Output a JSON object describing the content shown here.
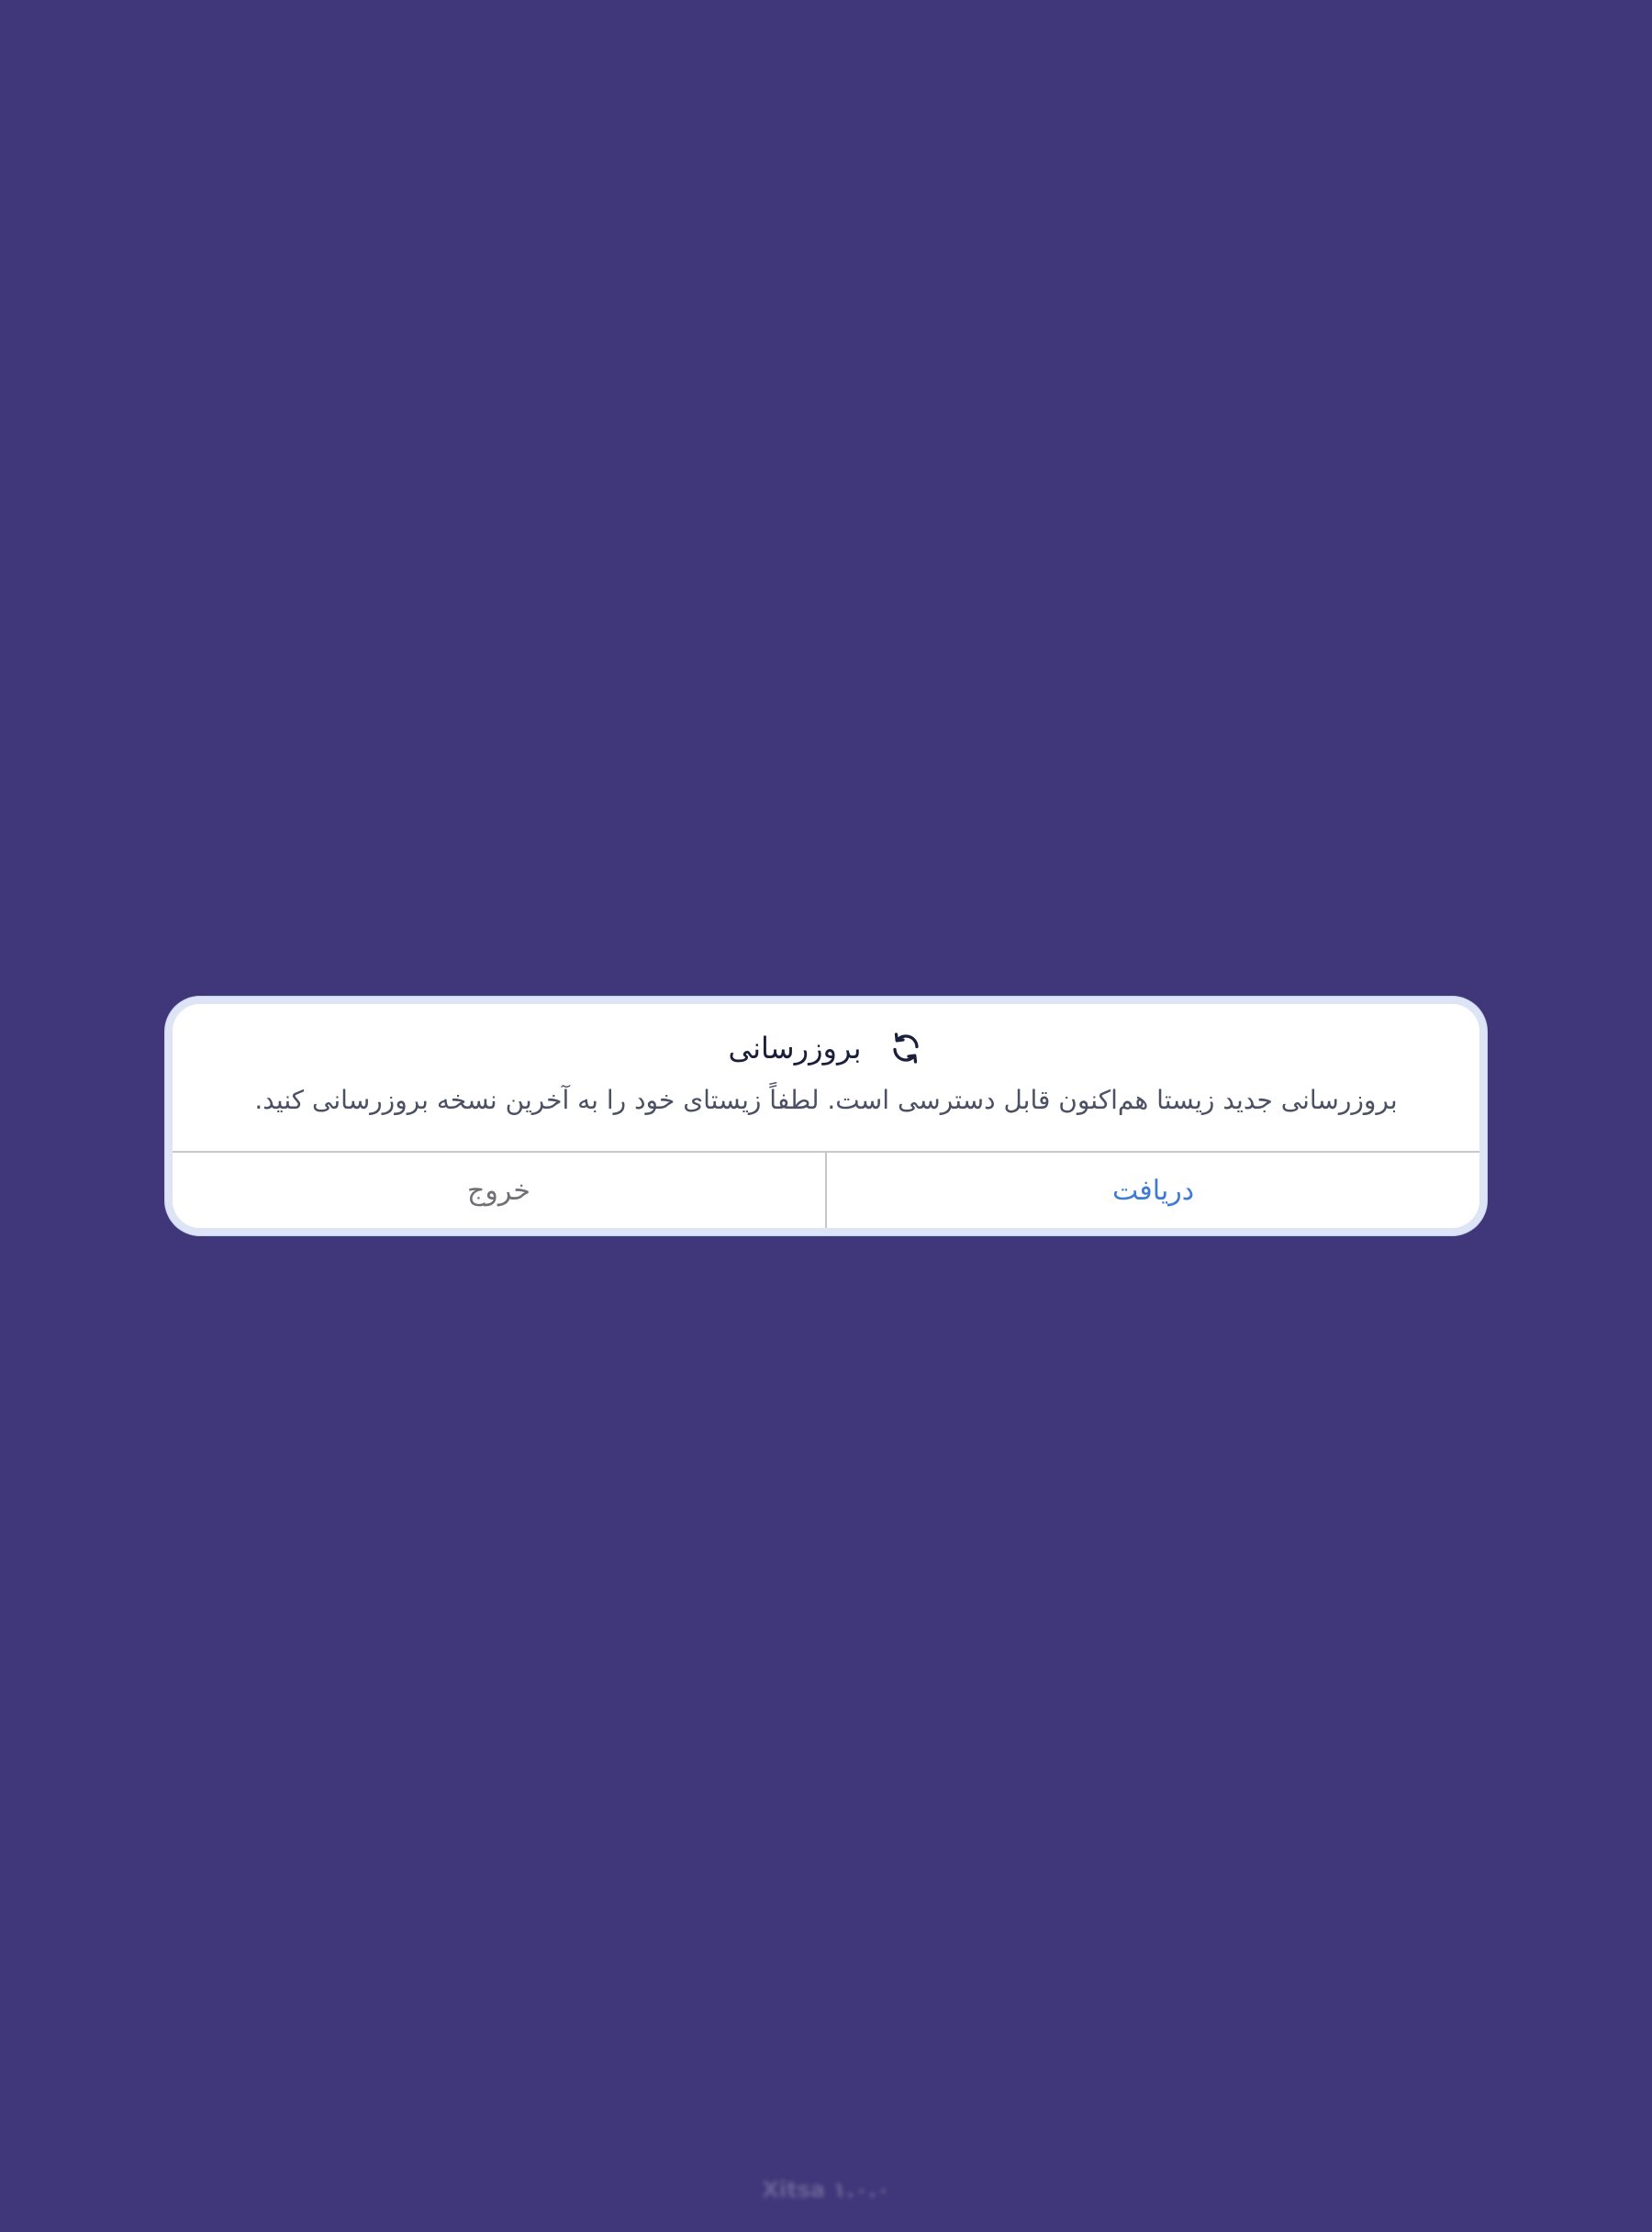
{
  "dialog": {
    "icon": "refresh-icon",
    "title": "بروزرسانی",
    "message": "بروزرسانی جدید زیستا هم‌اکنون قابل دسترسی است. لطفاً زیستای خود را به آخرین نسخه بروزرسانی کنید.",
    "primary_action": "دریافت",
    "secondary_action": "خروج"
  },
  "footer": {
    "version": "Xitsa ۱.۰.۰"
  },
  "colors": {
    "background": "#40377a",
    "dialog_border": "#dde4f6",
    "primary_action": "#3f7bd6",
    "secondary_action": "#6f6f76"
  }
}
